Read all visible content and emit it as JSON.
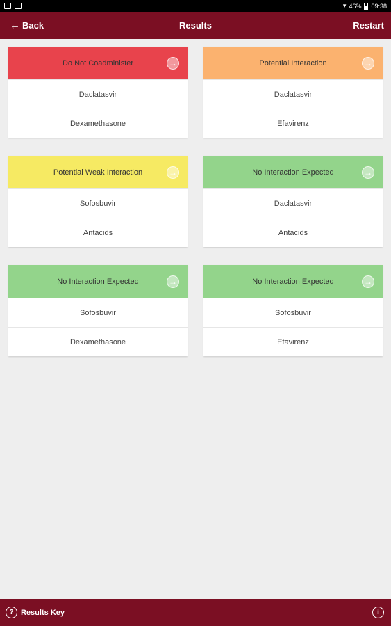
{
  "statusbar": {
    "battery": "46%",
    "time": "09:38"
  },
  "appbar": {
    "back_label": "Back",
    "title": "Results",
    "restart_label": "Restart"
  },
  "colors": {
    "brand": "#7b0f23",
    "red": "#e8434c",
    "orange": "#fbb26f",
    "yellow": "#f6ea63",
    "green": "#93d48b"
  },
  "results": [
    {
      "status": "Do Not Coadminister",
      "color": "#e8434c",
      "drugs": [
        "Daclatasvir",
        "Dexamethasone"
      ]
    },
    {
      "status": "Potential Interaction",
      "color": "#fbb26f",
      "drugs": [
        "Daclatasvir",
        "Efavirenz"
      ]
    },
    {
      "status": "Potential Weak Interaction",
      "color": "#f6ea63",
      "drugs": [
        "Sofosbuvir",
        "Antacids"
      ]
    },
    {
      "status": "No Interaction Expected",
      "color": "#93d48b",
      "drugs": [
        "Daclatasvir",
        "Antacids"
      ]
    },
    {
      "status": "No Interaction Expected",
      "color": "#93d48b",
      "drugs": [
        "Sofosbuvir",
        "Dexamethasone"
      ]
    },
    {
      "status": "No Interaction Expected",
      "color": "#93d48b",
      "drugs": [
        "Sofosbuvir",
        "Efavirenz"
      ]
    }
  ],
  "bottombar": {
    "key_label": "Results Key",
    "help_glyph": "?",
    "info_glyph": "i"
  }
}
